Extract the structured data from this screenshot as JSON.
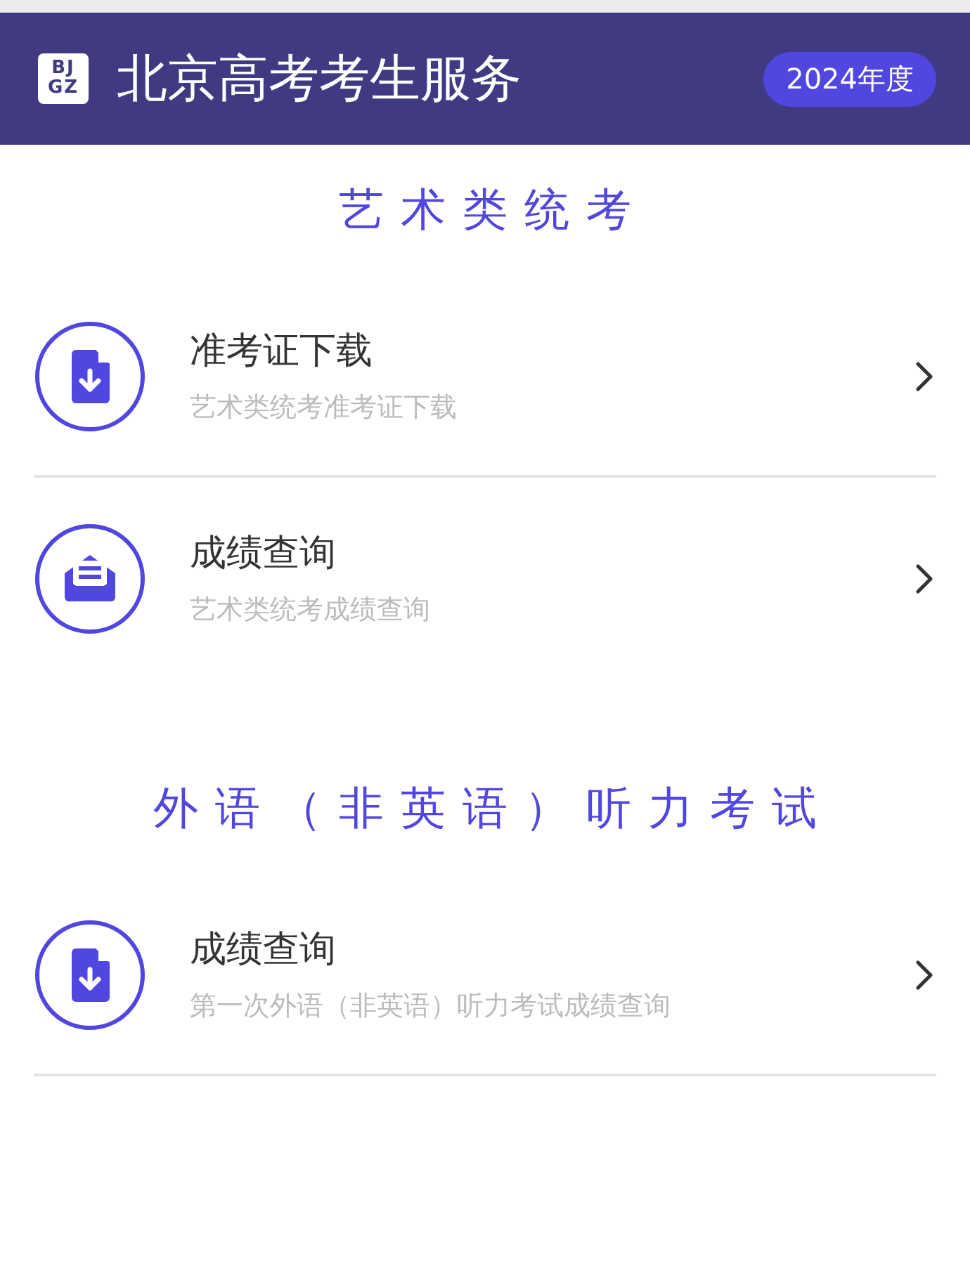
{
  "header": {
    "logo": [
      "BJ",
      "GZ"
    ],
    "title": "北京高考考生服务",
    "year_badge": "2024年度"
  },
  "sections": [
    {
      "title": "艺术类统考",
      "items": [
        {
          "kind": "download",
          "title": "准考证下载",
          "subtitle": "艺术类统考准考证下载",
          "divider_below": true
        },
        {
          "kind": "mail",
          "title": "成绩查询",
          "subtitle": "艺术类统考成绩查询",
          "divider_below": false
        }
      ]
    },
    {
      "title": "外语（非英语）听力考试",
      "items": [
        {
          "kind": "download",
          "title": "成绩查询",
          "subtitle": "第一次外语（非英语）听力考试成绩查询",
          "divider_below": true
        }
      ]
    }
  ]
}
